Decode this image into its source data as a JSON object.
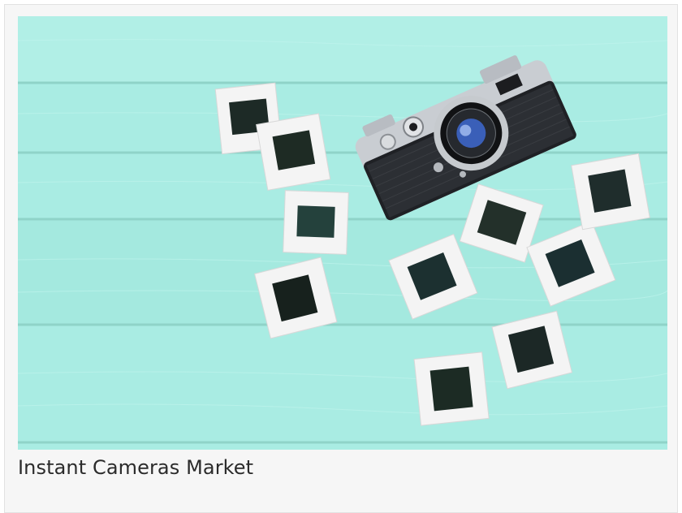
{
  "card": {
    "caption": "Instant Cameras Market"
  },
  "image": {
    "subject": "retro-rangefinder-camera-with-photo-slides",
    "background_color": "#a9ece3",
    "plank_line_color": "#8fd8cc",
    "slide_frame_color": "#f4f4f4"
  }
}
